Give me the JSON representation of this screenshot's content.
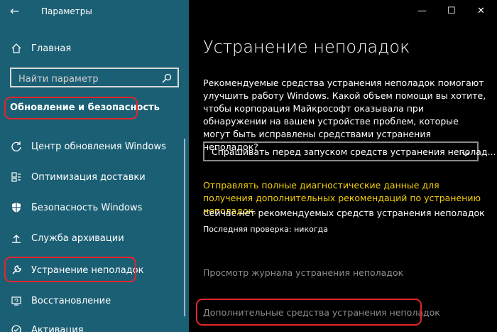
{
  "titlebar": {
    "back": "←",
    "title": "Параметры"
  },
  "window_controls": {
    "minimize": "—",
    "maximize": "☐",
    "close": "✕"
  },
  "sidebar": {
    "home": "Главная",
    "search_placeholder": "Найти параметр",
    "section_title": "Обновление и безопасность",
    "items": [
      {
        "label": "Центр обновления Windows",
        "icon": "refresh-icon"
      },
      {
        "label": "Оптимизация доставки",
        "icon": "delivery-icon"
      },
      {
        "label": "Безопасность Windows",
        "icon": "shield-icon"
      },
      {
        "label": "Служба архивации",
        "icon": "backup-icon"
      },
      {
        "label": "Устранение неполадок",
        "icon": "wrench-icon"
      },
      {
        "label": "Восстановление",
        "icon": "recovery-icon"
      },
      {
        "label": "Активация",
        "icon": "activation-icon"
      }
    ]
  },
  "main": {
    "title": "Устранение неполадок",
    "description": "Рекомендуемые средства устранения неполадок помогают улучшить работу Windows. Какой объем помощи вы хотите, чтобы корпорация Майкрософт оказывала при обнаружении на вашем устройстве проблем, которые могут быть исправлены средствами устранения неполадок?",
    "dropdown_value": "Спрашивать перед запуском средств устранения неполад...",
    "yellow_link": "Отправлять полные диагностические данные для получения дополнительных рекомендаций по устранению неполадок.",
    "status": "Сейчас нет рекомендуемых средств устранения неполадок",
    "last_check": "Последняя проверка: никогда",
    "history_link": "Просмотр журнала устранения неполадок",
    "additional_link": "Дополнительные средства устранения неполадок"
  },
  "colors": {
    "sidebar_bg": "#1b5f75",
    "main_bg": "#000000",
    "highlight": "#e3262b",
    "yellow": "#f5d10a",
    "link_gray": "#8e8e8e"
  }
}
